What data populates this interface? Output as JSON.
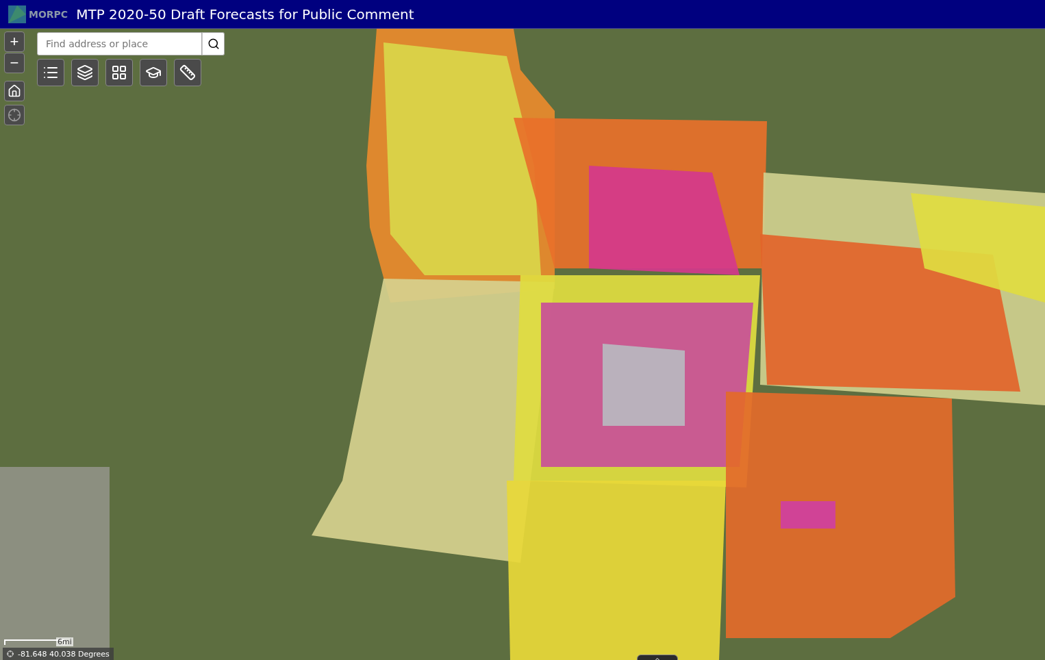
{
  "header": {
    "logo_text": "MORPC",
    "title": "MTP 2020-50 Draft Forecasts for Public Comment"
  },
  "search": {
    "placeholder": "Find address or place"
  },
  "zoom_controls": {
    "in": "+",
    "out": "−"
  },
  "toolbar": [
    {
      "kind": "legend"
    },
    {
      "kind": "layers"
    },
    {
      "kind": "basemap"
    },
    {
      "kind": "about"
    },
    {
      "kind": "measure"
    }
  ],
  "scale_bar": {
    "label": "6mi"
  },
  "coordinates": {
    "text": "-81.648 40.038 Degrees"
  }
}
